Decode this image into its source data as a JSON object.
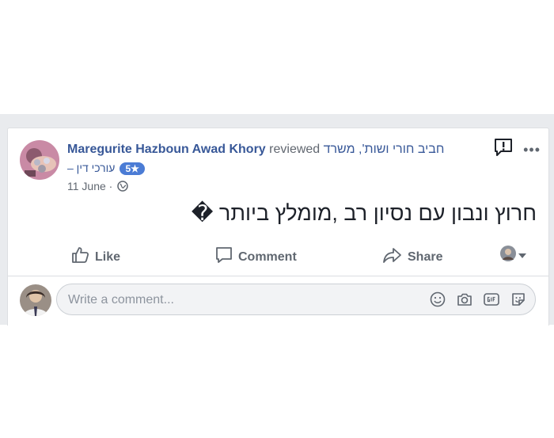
{
  "review": {
    "author": "Maregurite Hazboun Awad Khory",
    "verb": "reviewed",
    "page_name": "חביב חורי ושות', משרד",
    "page_name_line2": "עורכי דין –",
    "rating": "5",
    "rating_star": "★",
    "date": "11 June",
    "date_sep": "·",
    "post_text": "חרוץ ונבון עם נסיון רב ,מומלץ ביותר �",
    "more_icon": "•••"
  },
  "actions": {
    "like_label": "Like",
    "comment_label": "Comment",
    "share_label": "Share"
  },
  "comment": {
    "placeholder": "Write a comment..."
  },
  "colors": {
    "link": "#385898",
    "muted": "#606770",
    "badge": "#4b7cd5",
    "band": "#e9ebee"
  }
}
